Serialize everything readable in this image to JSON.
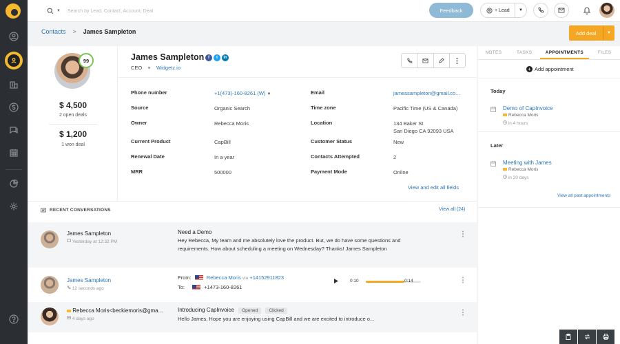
{
  "search": {
    "placeholder": "Search by Lead, Contact, Account, Deal"
  },
  "topbar": {
    "feedback_label": "Feedback",
    "lead_label": "+ Lead"
  },
  "breadcrumb": {
    "parent": "Contacts",
    "current": "James Sampleton"
  },
  "actions": {
    "add_deal_label": "Add deal"
  },
  "profile": {
    "score": "99",
    "open_deals_amount": "$ 4,500",
    "open_deals_label": "2 open deals",
    "won_deals_amount": "$ 1,200",
    "won_deals_label": "1 won deal"
  },
  "contact": {
    "name": "James Sampleton",
    "title": "CEO",
    "company": "Widgetz.io",
    "fields_left": [
      {
        "label": "Phone number",
        "value": "+1(473)-160-8261 (W)"
      },
      {
        "label": "Source",
        "value": "Organic Search"
      },
      {
        "label": "Owner",
        "value": "Rebecca Moris"
      },
      {
        "label": "Current Product",
        "value": "CapBill"
      },
      {
        "label": "Renewal Date",
        "value": "In a year"
      },
      {
        "label": "MRR",
        "value": "500000"
      }
    ],
    "fields_right": [
      {
        "label": "Email",
        "value": "jamessampleton@gmail.co..."
      },
      {
        "label": "Time zone",
        "value": "Pacific Time (US & Canada)"
      },
      {
        "label": "Location",
        "value": "134 Baker St",
        "value2": "San Diego CA 92093 USA"
      },
      {
        "label": "Customer Status",
        "value": "New"
      },
      {
        "label": "Contacts Attempted",
        "value": "2"
      },
      {
        "label": "Payment Mode",
        "value": "Online"
      }
    ],
    "view_edit_link": "View and edit all fields"
  },
  "conversations": {
    "title": "RECENT CONVERSATIONS",
    "view_all": "View all (24)",
    "items": [
      {
        "name": "James Sampleton",
        "time": "Yesterday at 12:32 PM",
        "subject": "Need a Demo",
        "body": "Hey Rebecca, My team and me absolutely love the product. But, we do have some questions and requirements. How about scheduling a meeting on Wednesday? Thanks! James Sampleton"
      },
      {
        "name": "James Sampleton",
        "time": "12 seconds ago",
        "from_label": "From:",
        "from_name": "Rebecca Moris",
        "from_via": "via",
        "from_number": "+14152911823",
        "to_label": "To:",
        "to_number": "+1473-160-8261",
        "elapsed": "0:10",
        "duration": "0:14",
        "progress": 0.7
      },
      {
        "name": "Rebecca Moris<beckiemoris@gma...",
        "time": "4 days ago",
        "subject": "Introducing CapInvoice",
        "badge_opened": "Opened",
        "badge_clicked": "Clicked",
        "body": "Hello James, Hope you are enjoying using CapBill and we are excited to introduce o..."
      }
    ]
  },
  "right_panel": {
    "tabs": [
      "NOTES",
      "TASKS",
      "APPOINTMENTS",
      "FILES"
    ],
    "add_label": "Add appointment",
    "today_label": "Today",
    "later_label": "Later",
    "appointments": [
      {
        "title": "Demo of CapInvoice",
        "owner": "Rebecca Moris",
        "time": "in 4 hours"
      },
      {
        "title": "Meeting with James",
        "owner": "Rebecca Moris",
        "time": "in 20 days"
      }
    ],
    "view_all_past": "View all past appointments"
  },
  "colors": {
    "accent": "#f5a623",
    "link": "#2c75b5",
    "sidebar": "#2b2f33",
    "feedback": "#8fbad6",
    "score_ring": "#7dc25c"
  }
}
